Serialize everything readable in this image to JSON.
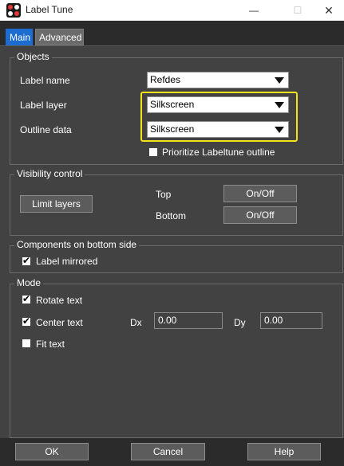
{
  "window": {
    "title": "Label Tune",
    "minimize_glyph": "—",
    "maximize_glyph": "☐",
    "close_glyph": "✕"
  },
  "tabs": [
    {
      "label": "Main",
      "active": true
    },
    {
      "label": "Advanced",
      "active": false
    }
  ],
  "objects": {
    "title": "Objects",
    "label_name": {
      "label": "Label name",
      "value": "Refdes"
    },
    "label_layer": {
      "label": "Label layer",
      "value": "Silkscreen"
    },
    "outline_data": {
      "label": "Outline data",
      "value": "Silkscreen"
    },
    "prioritize": {
      "label": "Prioritize Labeltune outline",
      "checked": false
    }
  },
  "visibility": {
    "title": "Visibility control",
    "limit_layers_label": "Limit layers",
    "top_label": "Top",
    "top_button": "On/Off",
    "bottom_label": "Bottom",
    "bottom_button": "On/Off"
  },
  "bottom_side": {
    "title": "Components on bottom side",
    "label_mirrored": {
      "label": "Label mirrored",
      "checked": true
    }
  },
  "mode": {
    "title": "Mode",
    "rotate_text": {
      "label": "Rotate text",
      "checked": true
    },
    "center_text": {
      "label": "Center text",
      "checked": true
    },
    "fit_text": {
      "label": "Fit text",
      "checked": false
    },
    "dx_label": "Dx",
    "dx_value": "0.00",
    "dy_label": "Dy",
    "dy_value": "0.00"
  },
  "footer": {
    "ok_label": "OK",
    "cancel_label": "Cancel",
    "help_label": "Help"
  },
  "colors": {
    "highlight": "#f2e418",
    "tab_active": "#1d6ccf",
    "panel_bg": "#424242"
  }
}
